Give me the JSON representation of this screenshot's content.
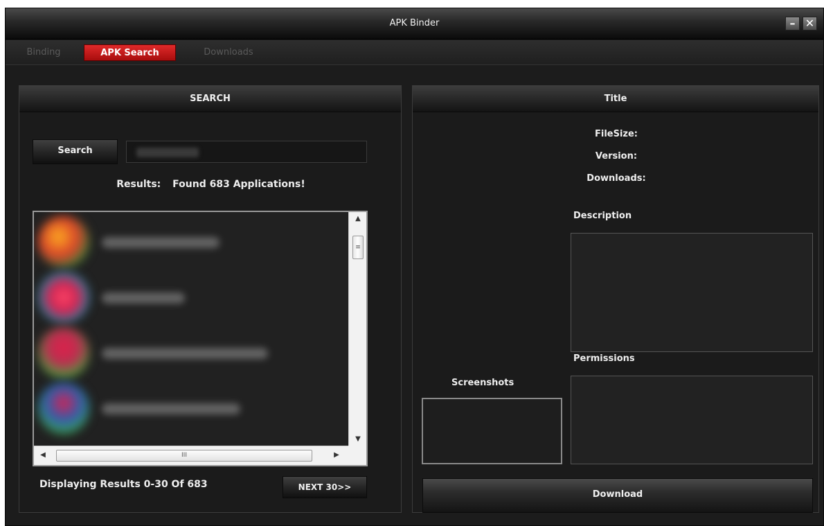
{
  "window": {
    "title": "APK Binder",
    "minimize_label": "–",
    "close_label": "✕"
  },
  "tabs": [
    {
      "label": "Binding",
      "active": false
    },
    {
      "label": "APK Search",
      "active": true
    },
    {
      "label": "Downloads",
      "active": false
    }
  ],
  "search_panel": {
    "header": "SEARCH",
    "search_button": "Search",
    "search_value": "",
    "results_label": "Results:",
    "results_text": "Found 683 Applications!",
    "display_text": "Displaying Results 0-30 Of 683",
    "next_button": "NEXT 30>>",
    "scroll_thumb_v": "≡",
    "scroll_thumb_h": "III",
    "arrow_up": "▲",
    "arrow_down": "▼",
    "arrow_left": "◀",
    "arrow_right": "▶"
  },
  "detail_panel": {
    "header": "Title",
    "filesize_label": "FileSize:",
    "version_label": "Version:",
    "downloads_label": "Downloads:",
    "description_label": "Description",
    "permissions_label": "Permissions",
    "screenshots_label": "Screenshots",
    "download_button": "Download"
  },
  "colors": {
    "active_tab": "#c41818",
    "background": "#1c1c1c"
  }
}
